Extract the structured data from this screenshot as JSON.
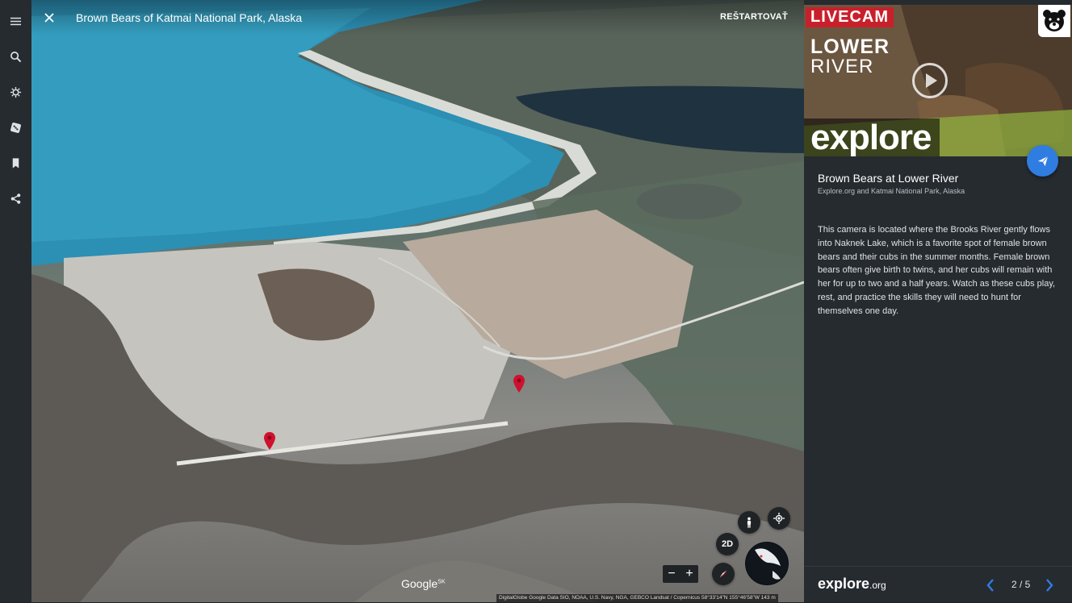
{
  "rail": {
    "items": [
      {
        "name": "menu-icon"
      },
      {
        "name": "search-icon"
      },
      {
        "name": "voyager-icon"
      },
      {
        "name": "dice-icon"
      },
      {
        "name": "bookmark-icon"
      },
      {
        "name": "share-icon"
      }
    ]
  },
  "map": {
    "title": "Brown Bears of Katmai National Park, Alaska",
    "restart_label": "REŠTARTOVAŤ",
    "view_mode_label": "2D",
    "zoom_out": "−",
    "zoom_in": "+",
    "google_logo": "Google",
    "google_logo_suffix": "SK",
    "attribution": "DigitalGlobe   Google   Data SIO, NOAA, U.S. Navy, NGA, GEBCO   Landsat / Copernicus         58°33'14\"N 155°46'58\"W    143 m"
  },
  "panel": {
    "hero": {
      "livecam_label": "LIVECAM",
      "title_line1": "LOWER",
      "title_line2": "RIVER",
      "brand": "explore"
    },
    "title": "Brown Bears at Lower River",
    "subtitle": "Explore.org and Katmai National Park, Alaska",
    "description": "This camera is located where the Brooks River gently flows into Naknek Lake, which is a favorite spot of female brown bears and their cubs in the summer months. Female brown bears often give birth to twins, and her cubs will remain with her for up to two and a half years. Watch as these cubs play, rest, and practice the skills they will need to hunt for themselves one day.",
    "footer_brand": "explore",
    "footer_brand_suffix": ".org",
    "pager": "2 / 5"
  },
  "colors": {
    "accent": "#2f7de1",
    "livecam_red": "#c8202b",
    "panel_bg": "#262b30",
    "pin_red": "#d0102e"
  }
}
